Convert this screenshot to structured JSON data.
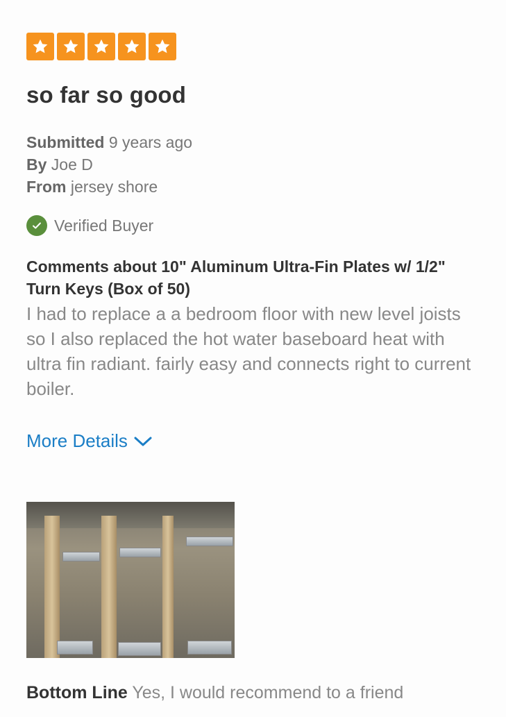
{
  "rating": {
    "stars": 5,
    "max": 5,
    "color": "#f6931e"
  },
  "review": {
    "title": "so far so good",
    "submitted_label": "Submitted",
    "submitted_value": "9 years ago",
    "by_label": "By",
    "by_value": "Joe D",
    "from_label": "From",
    "from_value": "jersey shore",
    "verified_label": "Verified Buyer",
    "comments_about": "Comments about 10\" Aluminum Ultra-Fin Plates w/ 1/2\" Turn Keys (Box of 50)",
    "body": "I had to replace a a bedroom floor with new level joists so I also replaced the hot water baseboard heat with ultra fin radiant. fairly easy and connects right to current boiler.",
    "more_details_label": "More Details",
    "bottom_line_label": "Bottom Line",
    "bottom_line_value": "Yes, I would recommend to a friend"
  },
  "colors": {
    "link": "#1b7ec6",
    "verified": "#5a8f3c"
  },
  "icons": {
    "star": "star-icon",
    "check": "check-circle-icon",
    "chevron": "chevron-down-icon"
  }
}
